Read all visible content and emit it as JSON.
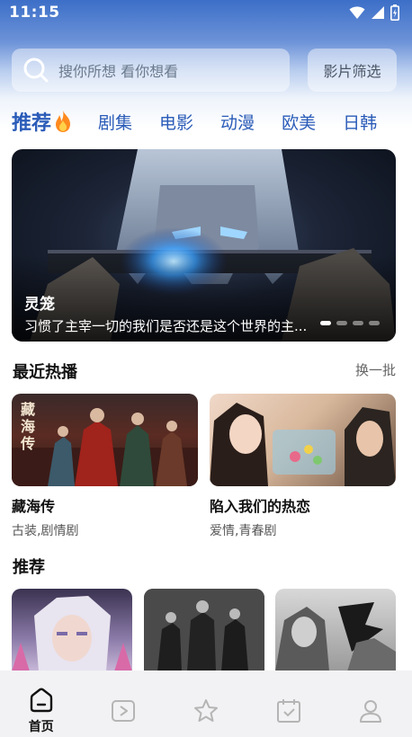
{
  "status_bar": {
    "time": "11:15"
  },
  "search": {
    "placeholder": "搜你所想 看你想看",
    "filter_label": "影片筛选"
  },
  "categories": {
    "active": "推荐",
    "tabs": [
      "剧集",
      "电影",
      "动漫",
      "欧美",
      "日韩"
    ]
  },
  "banner": {
    "title": "灵笼",
    "description": "习惯了主宰一切的我们是否还是这个世界的主...",
    "dots_total": 4,
    "active_dot": 0
  },
  "recent": {
    "title": "最近热播",
    "action": "换一批",
    "items": [
      {
        "title": "藏海传",
        "tags": "古装,剧情剧",
        "poster_text": "藏海传"
      },
      {
        "title": "陷入我们的热恋",
        "tags": "爱情,青春剧"
      }
    ]
  },
  "recommend": {
    "title": "推荐"
  },
  "bottom_nav": {
    "items": [
      {
        "label": "首页",
        "icon": "home-icon",
        "active": true
      },
      {
        "label": "",
        "icon": "play-icon"
      },
      {
        "label": "",
        "icon": "star-icon"
      },
      {
        "label": "",
        "icon": "calendar-check-icon"
      },
      {
        "label": "",
        "icon": "user-icon"
      }
    ]
  },
  "colors": {
    "accent": "#2a5bb8",
    "header_gradient_top": "#3c6fc8",
    "nav_bg": "#f2f2f4"
  }
}
